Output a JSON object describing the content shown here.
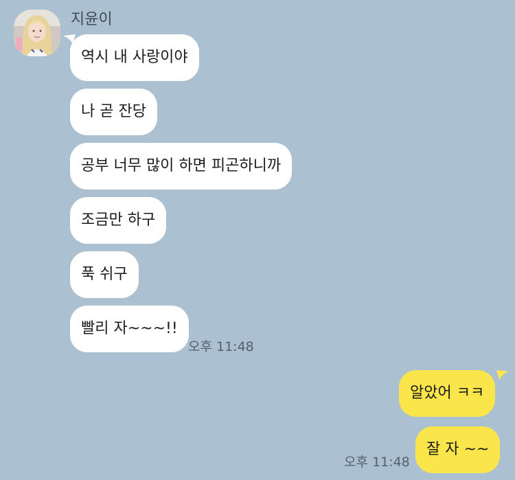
{
  "chat": {
    "sender_name": "지윤이",
    "incoming": [
      "역시 내 사랑이야",
      "나 곧 잔당",
      "공부 너무 많이 하면 피곤하니까",
      "조금만 하구",
      "푹 쉬구",
      "빨리 자~~~!!"
    ],
    "incoming_time": "오후 11:48",
    "outgoing": [
      "알았어 ㅋㅋ",
      "잘 자 ~~"
    ],
    "outgoing_time": "오후 11:48"
  },
  "colors": {
    "background": "#abc1d1",
    "incoming_bubble": "#ffffff",
    "outgoing_bubble": "#fae64b"
  },
  "icons": {
    "avatar": "profile-photo"
  }
}
